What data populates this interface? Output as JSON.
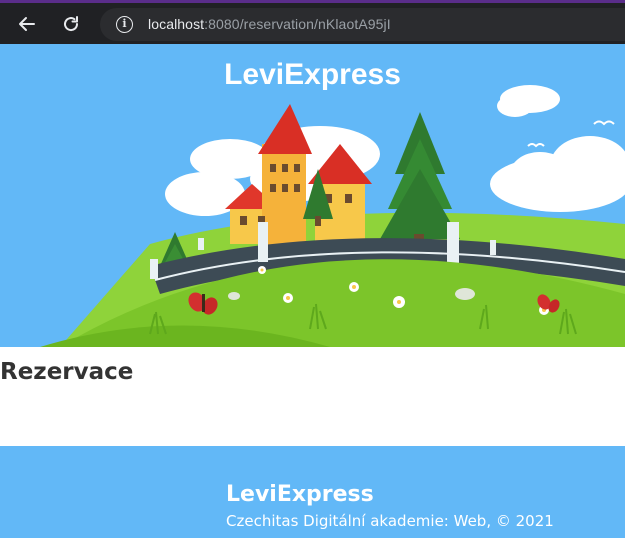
{
  "browser": {
    "url_host": "localhost",
    "url_rest": ":8080/reservation/nKlaotA95jI"
  },
  "hero": {
    "title": "LeviExpress"
  },
  "main": {
    "title": "Rezervace"
  },
  "footer": {
    "brand": "LeviExpress",
    "copyright": "Czechitas Digitální akademie: Web, © 2021"
  },
  "colors": {
    "sky": "#62b8f7",
    "grass": "#7cc52a",
    "road": "#3d4b55",
    "chrome": "#202124"
  }
}
